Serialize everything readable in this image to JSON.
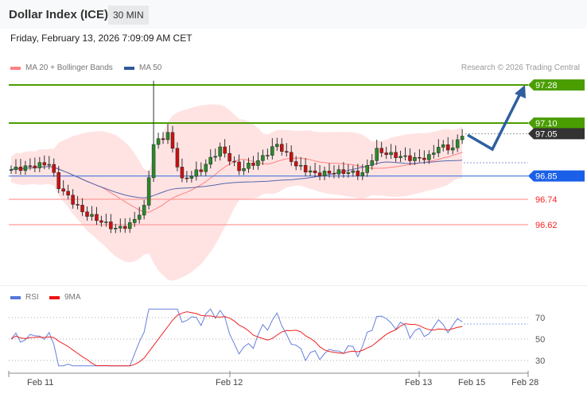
{
  "header": {
    "title": "Dollar Index (ICE)",
    "timeframe": "30 MIN",
    "date": "Friday, February 13, 2026 7:09:09 AM CET"
  },
  "legend": {
    "ma20": "MA 20 + Bollinger Bands",
    "ma50": "MA 50",
    "copyright": "Research © 2026 Trading Central"
  },
  "colors": {
    "resistance": "#4a9e00",
    "support": "#ff4d4d",
    "pivot": "#1a5fe8",
    "current": "#333333",
    "up": "#2a8a2a",
    "down": "#cc1111"
  },
  "levels": [
    {
      "value": 97.28,
      "label": "97.28",
      "type": "resistance"
    },
    {
      "value": 97.1,
      "label": "97.10",
      "type": "resistance"
    },
    {
      "value": 97.05,
      "label": "97.05",
      "type": "current"
    },
    {
      "value": 96.85,
      "label": "96.85",
      "type": "pivot"
    },
    {
      "value": 96.74,
      "label": "96.74",
      "type": "support"
    },
    {
      "value": 96.62,
      "label": "96.62",
      "type": "support"
    }
  ],
  "rsi": {
    "legend_rsi": "RSI",
    "legend_ma": "9MA",
    "ticks": [
      "70",
      "50",
      "30"
    ]
  },
  "xaxis": [
    "Feb 11",
    "Feb 12",
    "Feb 13",
    "Feb 15",
    "Feb 28"
  ],
  "chart_data": {
    "type": "candlestick",
    "close_keypoints": [
      [
        0,
        96.88
      ],
      [
        8,
        96.91
      ],
      [
        10,
        96.8
      ],
      [
        15,
        96.68
      ],
      [
        22,
        96.6
      ],
      [
        25,
        96.62
      ],
      [
        28,
        96.7
      ],
      [
        30,
        97.0
      ],
      [
        33,
        97.05
      ],
      [
        36,
        96.83
      ],
      [
        40,
        96.88
      ],
      [
        44,
        96.98
      ],
      [
        48,
        96.88
      ],
      [
        52,
        96.92
      ],
      [
        56,
        97.0
      ],
      [
        60,
        96.9
      ],
      [
        64,
        96.86
      ],
      [
        70,
        96.87
      ],
      [
        74,
        96.86
      ],
      [
        77,
        96.97
      ],
      [
        80,
        96.95
      ],
      [
        85,
        96.93
      ],
      [
        88,
        96.94
      ],
      [
        90,
        96.99
      ],
      [
        93,
        96.98
      ],
      [
        95,
        97.05
      ]
    ]
  }
}
